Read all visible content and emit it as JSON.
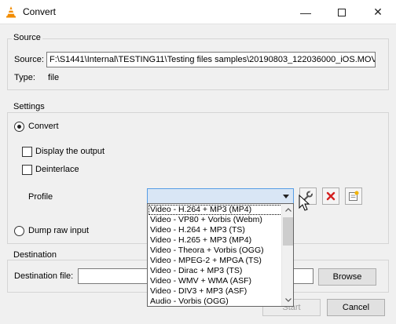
{
  "window": {
    "title": "Convert",
    "minimize_glyph": "—",
    "close_glyph": "✕"
  },
  "source": {
    "group_title": "Source",
    "source_label": "Source:",
    "source_value": "F:\\S1441\\Internal\\TESTING11\\Testing files samples\\20190803_122036000_iOS.MOV",
    "type_label": "Type:",
    "type_value": "file"
  },
  "settings": {
    "group_title": "Settings",
    "convert_label": "Convert",
    "display_output_label": "Display the output",
    "deinterlace_label": "Deinterlace",
    "profile_label": "Profile",
    "profile_selected": "",
    "dump_raw_label": "Dump raw input"
  },
  "profiles": [
    "Video - H.264 + MP3 (MP4)",
    "Video - VP80 + Vorbis (Webm)",
    "Video - H.264 + MP3 (TS)",
    "Video - H.265 + MP3 (MP4)",
    "Video - Theora + Vorbis (OGG)",
    "Video - MPEG-2 + MPGA (TS)",
    "Video - Dirac + MP3 (TS)",
    "Video - WMV + WMA (ASF)",
    "Video - DIV3 + MP3 (ASF)",
    "Audio - Vorbis (OGG)"
  ],
  "destination": {
    "group_title": "Destination",
    "file_label": "Destination file:",
    "file_value": "",
    "browse_label": "Browse"
  },
  "footer": {
    "start_label": "Start",
    "cancel_label": "Cancel"
  },
  "icons": {
    "app": "vlc-cone-icon",
    "edit_profile": "wrench-icon",
    "delete_profile": "red-x-icon",
    "new_profile": "new-profile-icon"
  },
  "colors": {
    "combo_focus": "#569de5",
    "delete_red": "#d42020",
    "vlc_orange": "#f28c00"
  }
}
